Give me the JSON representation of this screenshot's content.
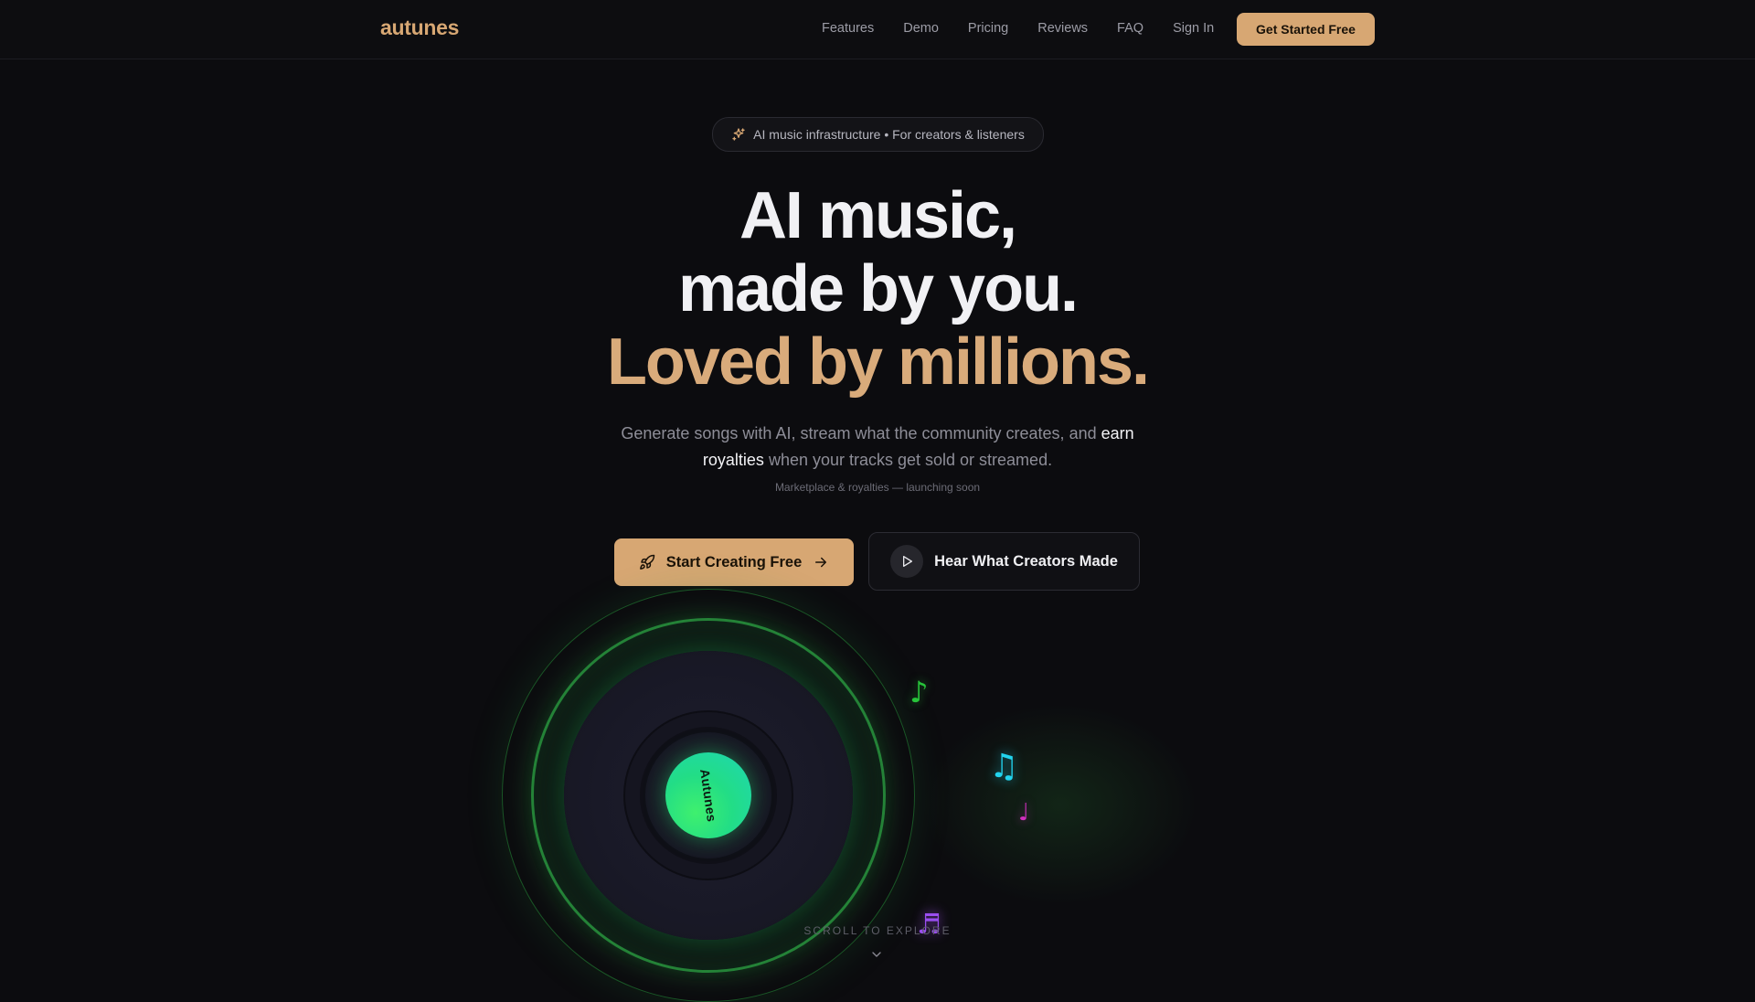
{
  "nav": {
    "logo": "autunes",
    "links": [
      "Features",
      "Demo",
      "Pricing",
      "Reviews",
      "FAQ",
      "Sign In"
    ],
    "cta": "Get Started Free"
  },
  "hero": {
    "badge": "AI music infrastructure • For creators & listeners",
    "headline_line1": "AI music,",
    "headline_line2": "made by you.",
    "headline_line3": "Loved by millions.",
    "sub_part1": "Generate songs with AI, stream what the community creates, and ",
    "sub_highlight": "earn royalties",
    "sub_part2": " when your tracks get sold or streamed.",
    "note": "Marketplace & royalties — launching soon",
    "primary_button": "Start Creating Free",
    "secondary_button": "Hear What Creators Made"
  },
  "visual": {
    "record_label": "Autunes",
    "notes": [
      "♪",
      "♫",
      "♩",
      "♬"
    ]
  },
  "scroll_hint": "SCROLL TO EXPLORE",
  "colors": {
    "background": "#0c0c0f",
    "accent_gold": "#d7a773",
    "headline_gold": "#d9ab7b",
    "ring_green": "#2eaa46",
    "label_green": "#22dd86"
  }
}
